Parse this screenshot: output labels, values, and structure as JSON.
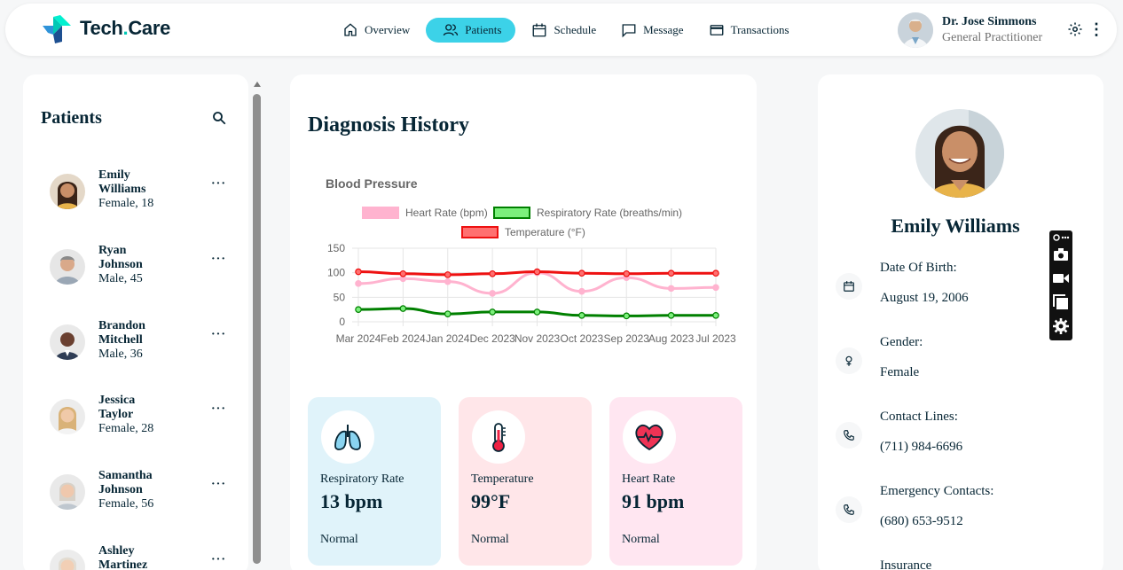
{
  "app": {
    "name_part1": "Tech",
    "name_dot": ".",
    "name_part2": "Care"
  },
  "nav": {
    "items": [
      {
        "label": "Overview",
        "icon": "home-icon"
      },
      {
        "label": "Patients",
        "icon": "patients-icon",
        "active": true
      },
      {
        "label": "Schedule",
        "icon": "calendar-icon"
      },
      {
        "label": "Message",
        "icon": "message-icon"
      },
      {
        "label": "Transactions",
        "icon": "credit-card-icon"
      }
    ]
  },
  "doctor": {
    "name": "Dr. Jose Simmons",
    "role": "General Practitioner"
  },
  "patients": {
    "title": "Patients",
    "list": [
      {
        "name": "Emily Williams",
        "meta": "Female, 18"
      },
      {
        "name": "Ryan Johnson",
        "meta": "Male, 45"
      },
      {
        "name": "Brandon Mitchell",
        "meta": "Male, 36"
      },
      {
        "name": "Jessica Taylor",
        "meta": "Female, 28"
      },
      {
        "name": "Samantha Johnson",
        "meta": "Female, 56"
      },
      {
        "name": "Ashley Martinez",
        "meta": ""
      }
    ],
    "more": "···"
  },
  "diagnosis": {
    "title": "Diagnosis History",
    "vitals": [
      {
        "label": "Respiratory Rate",
        "value": "13 bpm",
        "status": "Normal",
        "bg": "#e0f3fa",
        "icon": "lungs-icon"
      },
      {
        "label": "Temperature",
        "value": "99°F",
        "status": "Normal",
        "bg": "#ffe6e9",
        "icon": "thermometer-icon"
      },
      {
        "label": "Heart Rate",
        "value": "91 bpm",
        "status": "Normal",
        "bg": "#ffe6f1",
        "icon": "heart-icon"
      }
    ]
  },
  "chart_data": {
    "type": "line",
    "title": "Blood Pressure",
    "categories": [
      "Mar 2024",
      "Feb 2024",
      "Jan 2024",
      "Dec 2023",
      "Nov 2023",
      "Oct 2023",
      "Sep 2023",
      "Aug 2023",
      "Jul 2023"
    ],
    "series": [
      {
        "name": "Heart Rate (bpm)",
        "values": [
          78,
          88,
          82,
          58,
          100,
          62,
          90,
          68,
          70
        ],
        "color": "#ffb3cf",
        "fill": "#ffb3cf"
      },
      {
        "name": "Respiratory Rate (breaths/min)",
        "values": [
          25,
          27,
          16,
          20,
          20,
          13,
          12,
          13,
          13
        ],
        "color": "#008000",
        "fill": "#7cf07c"
      },
      {
        "name": "Temperature (°F)",
        "values": [
          102,
          98,
          96,
          98,
          102,
          99,
          98,
          99,
          99
        ],
        "color": "#ee1111",
        "fill": "#ff7070"
      }
    ],
    "yticks": [
      "150",
      "100",
      "50",
      "0"
    ],
    "ylim": [
      0,
      150
    ],
    "grid": true,
    "legend": "top"
  },
  "profile": {
    "name": "Emily Williams",
    "rows": [
      {
        "label": "Date Of Birth:",
        "value": "August 19, 2006",
        "icon": "calendar-icon"
      },
      {
        "label": "Gender:",
        "value": "Female",
        "icon": "female-icon"
      },
      {
        "label": "Contact Lines:",
        "value": "(711) 984-6696",
        "icon": "phone-icon"
      },
      {
        "label": "Emergency Contacts:",
        "value": "(680) 653-9512",
        "icon": "phone-icon"
      },
      {
        "label": "Insurance",
        "value": "",
        "icon": "shield-icon"
      }
    ]
  },
  "colors": {
    "accent": "#01f0d0",
    "active_nav": "#3cd2e8",
    "text": "#072635"
  }
}
